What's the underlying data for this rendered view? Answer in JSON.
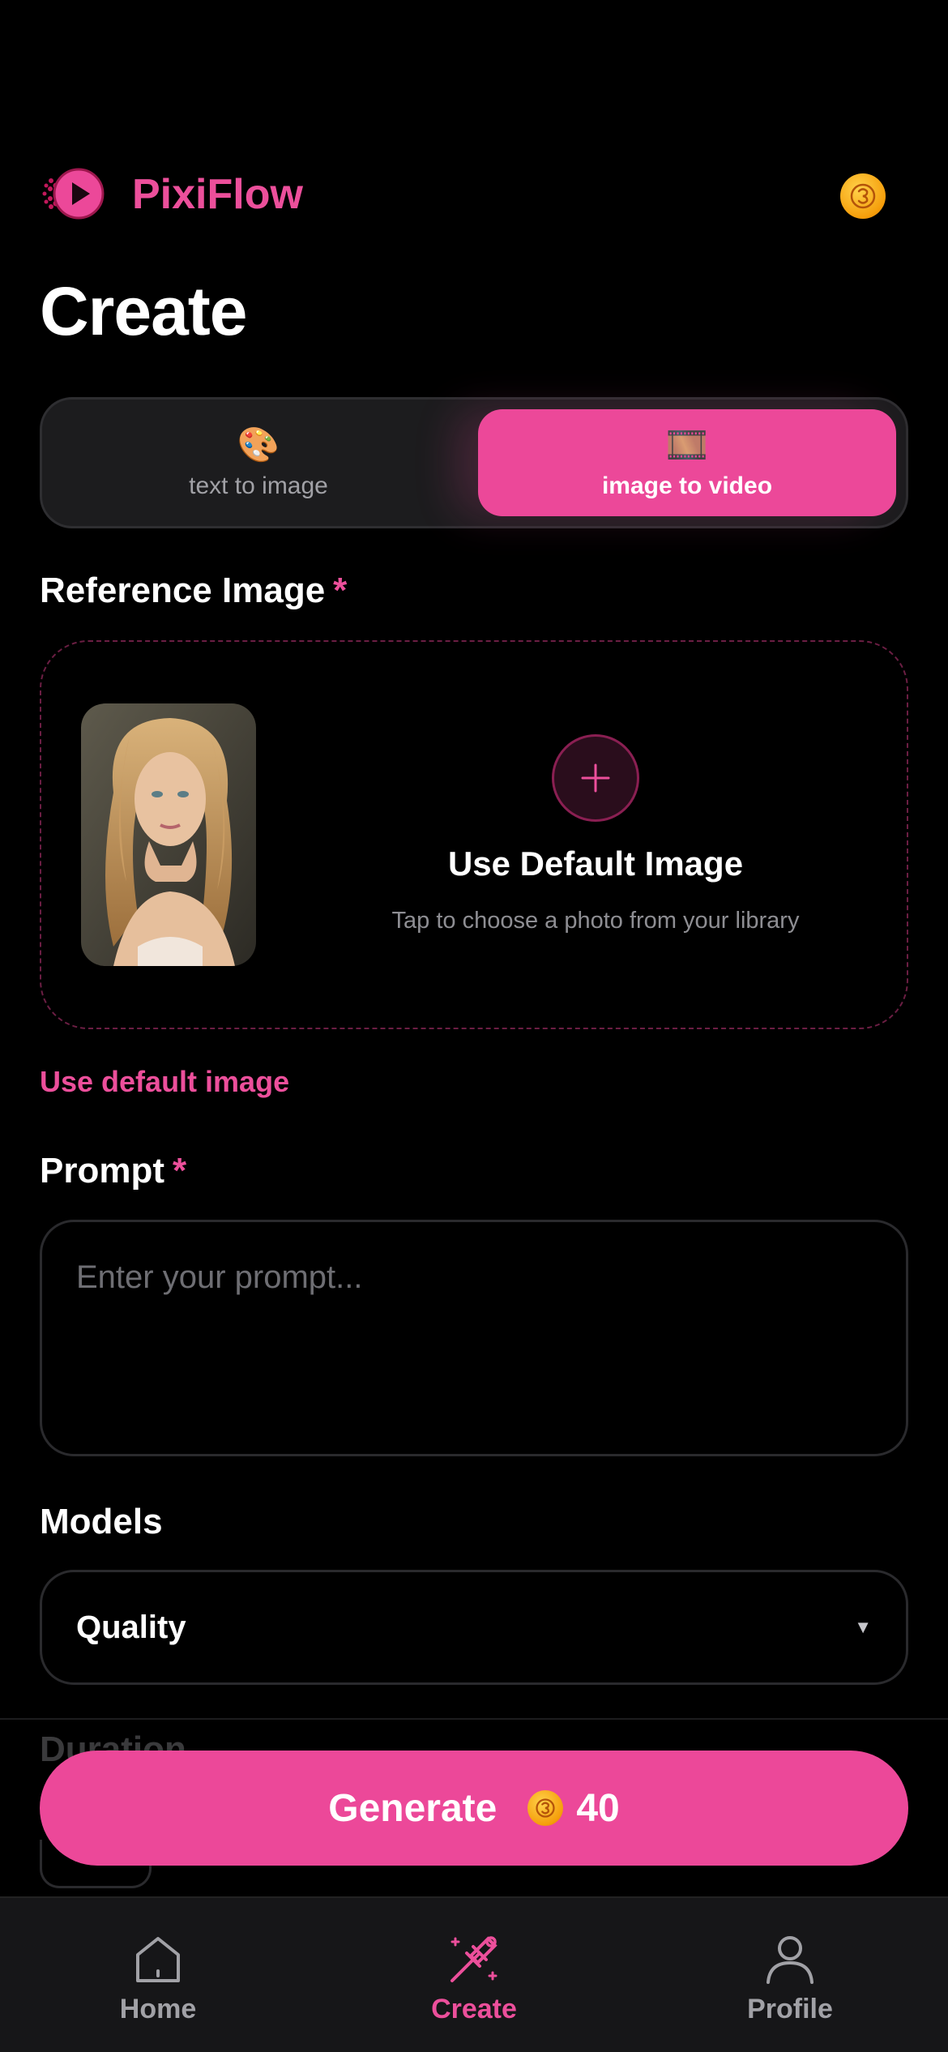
{
  "header": {
    "app_name": "PixiFlow",
    "coin_icon": "coin-icon",
    "brand_color": "#ec4899"
  },
  "page": {
    "title": "Create"
  },
  "mode_tabs": [
    {
      "emoji": "🎨",
      "label": "text to image",
      "active": false
    },
    {
      "emoji": "🎞️",
      "label": "image to video",
      "active": true
    }
  ],
  "reference": {
    "label": "Reference Image",
    "required_mark": "*",
    "upload_title": "Use Default Image",
    "upload_subtitle": "Tap to choose a photo from your library",
    "default_link": "Use default image"
  },
  "prompt": {
    "label": "Prompt",
    "required_mark": "*",
    "placeholder": "Enter your prompt..."
  },
  "models": {
    "label": "Models",
    "selected": "Quality"
  },
  "duration": {
    "label": "Duration"
  },
  "generate": {
    "label": "Generate",
    "cost": "40"
  },
  "tabbar": [
    {
      "label": "Home",
      "icon": "home-icon",
      "active": false
    },
    {
      "label": "Create",
      "icon": "magic-wand-icon",
      "active": true
    },
    {
      "label": "Profile",
      "icon": "person-icon",
      "active": false
    }
  ]
}
